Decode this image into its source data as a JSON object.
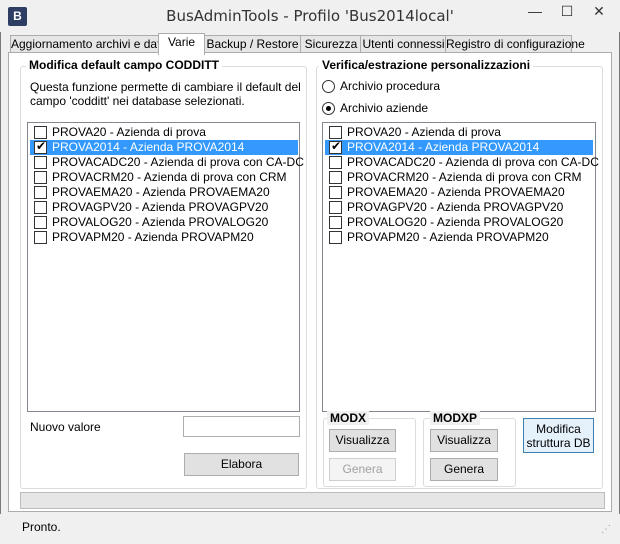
{
  "window": {
    "title": "BusAdminTools - Profilo 'Bus2014local'",
    "app_icon": "B",
    "minimize": "—",
    "maximize": "☐",
    "close": "✕"
  },
  "tabs": [
    {
      "label": "Aggiornamento archivi e dati"
    },
    {
      "label": "Varie"
    },
    {
      "label": "Backup / Restore"
    },
    {
      "label": "Sicurezza"
    },
    {
      "label": "Utenti connessi"
    },
    {
      "label": "Registro di configurazione"
    }
  ],
  "left_group": {
    "title": "Modifica default campo CODDITT",
    "description_line1": "Questa funzione permette di cambiare il default del",
    "description_line2": "campo 'codditt' nei database selezionati.",
    "items": [
      {
        "label": "PROVA20 - Azienda di prova",
        "checked": false
      },
      {
        "label": "PROVA2014 - Azienda PROVA2014",
        "checked": true
      },
      {
        "label": "PROVACADC20 - Azienda di prova con CA-DC",
        "checked": false
      },
      {
        "label": "PROVACRM20 - Azienda di prova con CRM",
        "checked": false
      },
      {
        "label": "PROVAEMA20 - Azienda PROVAEMA20",
        "checked": false
      },
      {
        "label": "PROVAGPV20 - Azienda PROVAGPV20",
        "checked": false
      },
      {
        "label": "PROVALOG20 - Azienda PROVALOG20",
        "checked": false
      },
      {
        "label": "PROVAPM20 - Azienda PROVAPM20",
        "checked": false
      }
    ],
    "new_value_label": "Nuovo valore",
    "new_value": "",
    "elabora_label": "Elabora"
  },
  "right_group": {
    "title": "Verifica/estrazione personalizzazioni",
    "radio_procedura": "Archivio procedura",
    "radio_aziende": "Archivio aziende",
    "items": [
      {
        "label": "PROVA20 - Azienda di prova",
        "checked": false
      },
      {
        "label": "PROVA2014 - Azienda PROVA2014",
        "checked": true
      },
      {
        "label": "PROVACADC20 - Azienda di prova con CA-DC",
        "checked": false
      },
      {
        "label": "PROVACRM20 - Azienda di prova con CRM",
        "checked": false
      },
      {
        "label": "PROVAEMA20 - Azienda PROVAEMA20",
        "checked": false
      },
      {
        "label": "PROVAGPV20 - Azienda PROVAGPV20",
        "checked": false
      },
      {
        "label": "PROVALOG20 - Azienda PROVALOG20",
        "checked": false
      },
      {
        "label": "PROVAPM20 - Azienda PROVAPM20",
        "checked": false
      }
    ],
    "modx": {
      "title": "MODX",
      "visualizza": "Visualizza",
      "genera": "Genera"
    },
    "modxp": {
      "title": "MODXP",
      "visualizza": "Visualizza",
      "genera": "Genera"
    },
    "modifica_line1": "Modifica",
    "modifica_line2": "struttura DB"
  },
  "status": {
    "text": "Pronto.",
    "grip": "⋰"
  },
  "colors": {
    "selection": "#3399ff",
    "titlebar": "#f0f0f0"
  }
}
